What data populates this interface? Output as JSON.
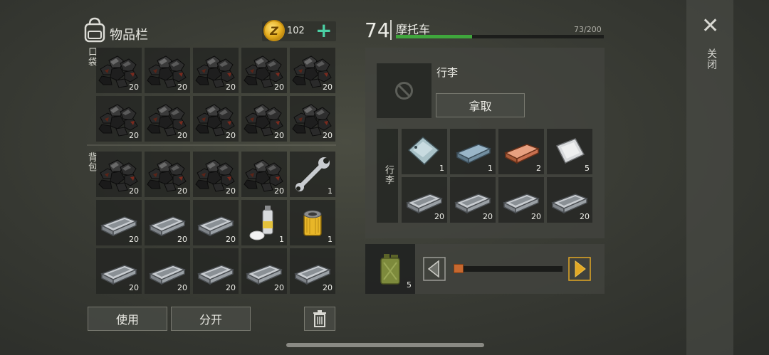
{
  "inventory": {
    "title": "物品栏",
    "coins": "102",
    "coin_symbol": "Z",
    "pocket_label": "口袋",
    "backpack_label": "背包",
    "pocket_slots": [
      {
        "item": "coal",
        "count": "20"
      },
      {
        "item": "coal",
        "count": "20"
      },
      {
        "item": "coal",
        "count": "20"
      },
      {
        "item": "coal",
        "count": "20"
      },
      {
        "item": "coal",
        "count": "20"
      },
      {
        "item": "coal",
        "count": "20"
      },
      {
        "item": "coal",
        "count": "20"
      },
      {
        "item": "coal",
        "count": "20"
      },
      {
        "item": "coal",
        "count": "20"
      },
      {
        "item": "coal",
        "count": "20"
      }
    ],
    "backpack_slots": [
      {
        "item": "coal",
        "count": "20"
      },
      {
        "item": "coal",
        "count": "20"
      },
      {
        "item": "coal",
        "count": "20"
      },
      {
        "item": "coal",
        "count": "20"
      },
      {
        "item": "wrench",
        "count": "1"
      },
      {
        "item": "iron-ingot",
        "count": "20"
      },
      {
        "item": "iron-ingot",
        "count": "20"
      },
      {
        "item": "iron-ingot",
        "count": "20"
      },
      {
        "item": "spray-can",
        "count": "1"
      },
      {
        "item": "oil-filter",
        "count": "1"
      },
      {
        "item": "iron-ingot",
        "count": "20"
      },
      {
        "item": "iron-ingot",
        "count": "20"
      },
      {
        "item": "iron-ingot",
        "count": "20"
      },
      {
        "item": "iron-ingot",
        "count": "20"
      },
      {
        "item": "iron-ingot",
        "count": "20"
      }
    ],
    "use_label": "使用",
    "split_label": "分开"
  },
  "vehicle": {
    "level": "74",
    "name": "摩托车",
    "capacity": "73/200",
    "capacity_fraction": 0.365,
    "luggage_title": "行李",
    "take_label": "拿取",
    "trunk_label": "行李",
    "trunk_slots": [
      {
        "item": "steel-plate",
        "count": "1"
      },
      {
        "item": "aluminum-ingot",
        "count": "1"
      },
      {
        "item": "copper-ingot",
        "count": "2"
      },
      {
        "item": "silver-plate",
        "count": "5"
      },
      {
        "item": "iron-ingot",
        "count": "20"
      },
      {
        "item": "iron-ingot",
        "count": "20"
      },
      {
        "item": "iron-ingot",
        "count": "20"
      },
      {
        "item": "iron-ingot",
        "count": "20"
      }
    ],
    "fuel_count": "5",
    "fuel_level": 0.0
  },
  "close_label": "关闭",
  "colors": {
    "accent_green": "#4bd1a5",
    "capacity_green": "#3fa63c",
    "arrow_gold": "#e2a825"
  }
}
